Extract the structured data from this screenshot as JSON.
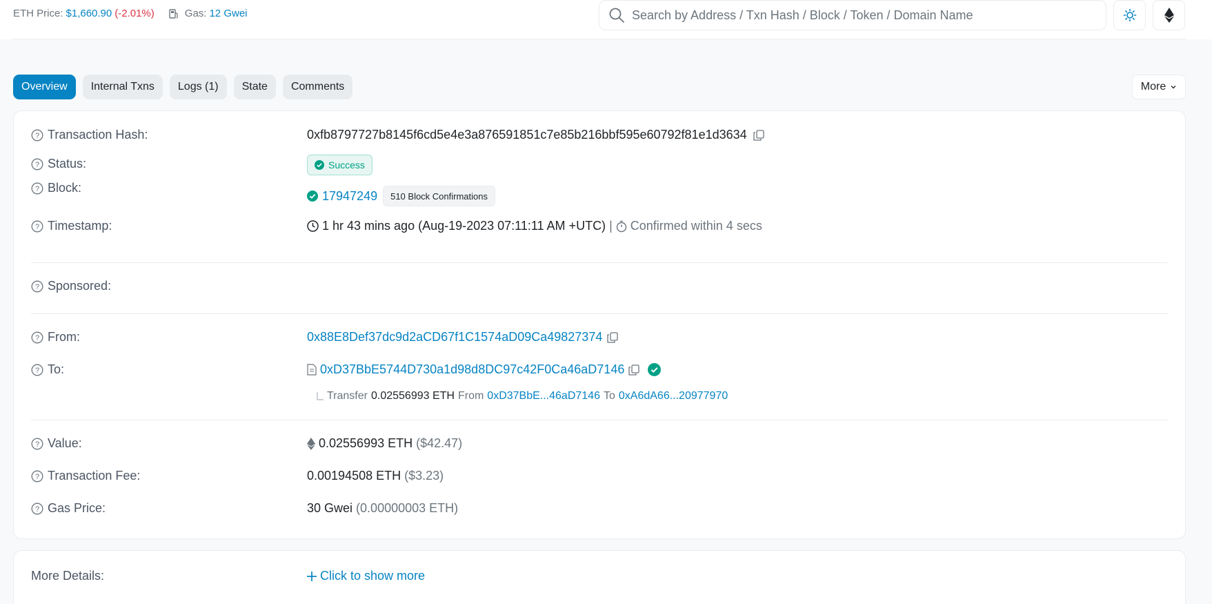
{
  "header": {
    "eth_price_label": "ETH Price:",
    "eth_price_value": "$1,660.90",
    "eth_price_change": "(-2.01%)",
    "gas_label": "Gas:",
    "gas_value": "12 Gwei",
    "search_placeholder": "Search by Address / Txn Hash / Block / Token / Domain Name",
    "icons": [
      "gas-pump-icon",
      "search-icon",
      "sun-icon",
      "ethereum-icon"
    ]
  },
  "tabs": [
    {
      "label": "Overview",
      "active": true
    },
    {
      "label": "Internal Txns",
      "active": false
    },
    {
      "label": "Logs (1)",
      "active": false
    },
    {
      "label": "State",
      "active": false
    },
    {
      "label": "Comments",
      "active": false
    }
  ],
  "more_label": "More",
  "overview": {
    "tx_hash_label": "Transaction Hash:",
    "tx_hash": "0xfb8797727b8145f6cd5e4e3a876591851c7e85b216bbf595e60792f81e1d3634",
    "status_label": "Status:",
    "status": "Success",
    "block_label": "Block:",
    "block": "17947249",
    "block_confirmations": "510 Block Confirmations",
    "timestamp_label": "Timestamp:",
    "timestamp": "1 hr 43 mins ago (Aug-19-2023 07:11:11 AM +UTC)",
    "timestamp_sep": "|",
    "confirmed_within": "Confirmed within 4 secs",
    "sponsored_label": "Sponsored:",
    "from_label": "From:",
    "from": "0x88E8Def37dc9d2aCD67f1C1574aD09Ca49827374",
    "to_label": "To:",
    "to": "0xD37BbE5744D730a1d98d8DC97c42F0Ca46aD7146",
    "transfer": {
      "prefix": "Transfer",
      "amount": "0.02556993 ETH",
      "from_label": "From",
      "from": "0xD37BbE...46aD7146",
      "to_label": "To",
      "to": "0xA6dA66...20977970"
    },
    "value_label": "Value:",
    "value": "0.02556993 ETH",
    "value_usd": "($42.47)",
    "fee_label": "Transaction Fee:",
    "fee": "0.00194508 ETH",
    "fee_usd": "($3.23)",
    "gas_price_label": "Gas Price:",
    "gas_price": "30 Gwei",
    "gas_price_eth": "(0.00000003 ETH)"
  },
  "more_details": {
    "label": "More Details:",
    "link": "Click to show more"
  },
  "colors": {
    "accent": "#0784c3",
    "success": "#00a186",
    "negative": "#dc3545"
  }
}
